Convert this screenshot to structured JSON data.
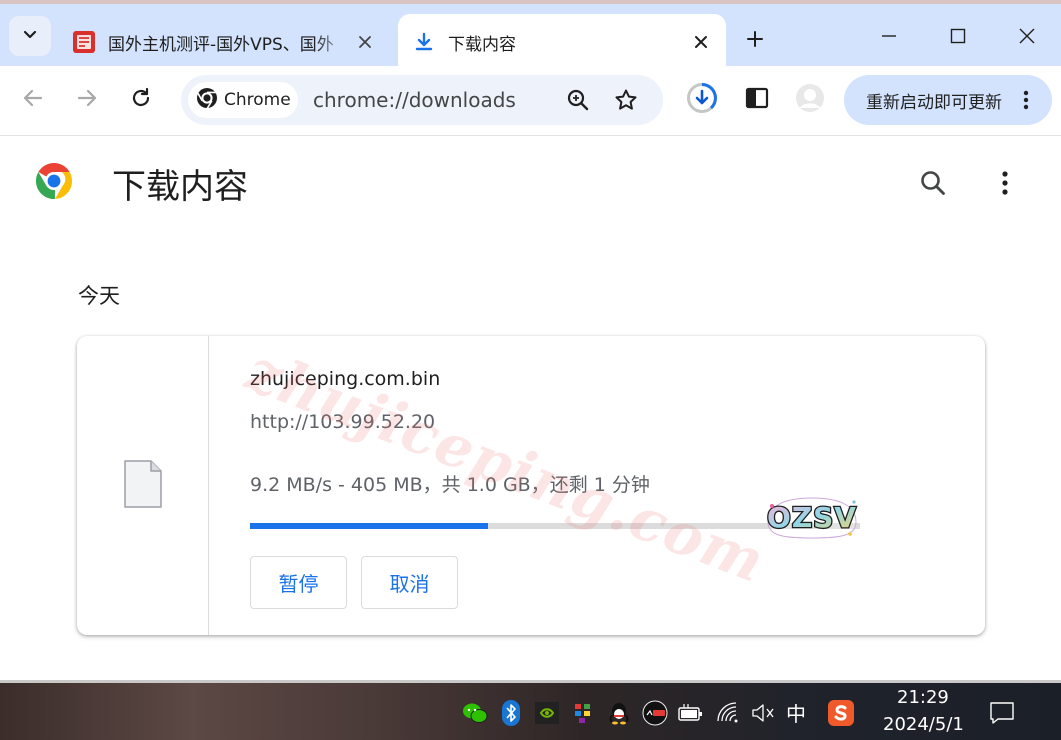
{
  "tabs": [
    {
      "title": "国外主机测评-国外VPS、国外",
      "favicon": "zhujiceping-site-icon",
      "active": false
    },
    {
      "title": "下载内容",
      "favicon": "download-icon",
      "active": true
    }
  ],
  "toolbar": {
    "site_chip": "Chrome",
    "url": "chrome://downloads",
    "update_button": "重新启动即可更新"
  },
  "page": {
    "title": "下载内容",
    "section_label": "今天"
  },
  "download": {
    "file_name": "zhujiceping.com.bin",
    "source_url": "http://103.99.52.20",
    "status": "9.2 MB/s - 405 MB，共 1.0 GB，还剩 1 分钟",
    "progress_fraction": 0.39,
    "pause_label": "暂停",
    "cancel_label": "取消"
  },
  "watermark": "zhujiceping.com",
  "badge_text": "OZSV",
  "taskbar": {
    "tray_icons": [
      "wechat-icon",
      "bluetooth-icon",
      "nvidia-icon",
      "color-grid-icon",
      "qq-icon",
      "app-badge-icon",
      "battery-icon",
      "wifi-icon",
      "volume-muted-icon"
    ],
    "ime": "中",
    "time": "21:29",
    "date": "2024/5/1"
  },
  "colors": {
    "accent": "#1a73e8",
    "tabstrip": "#d3e3fd",
    "update_button": "#d3e3fd"
  }
}
